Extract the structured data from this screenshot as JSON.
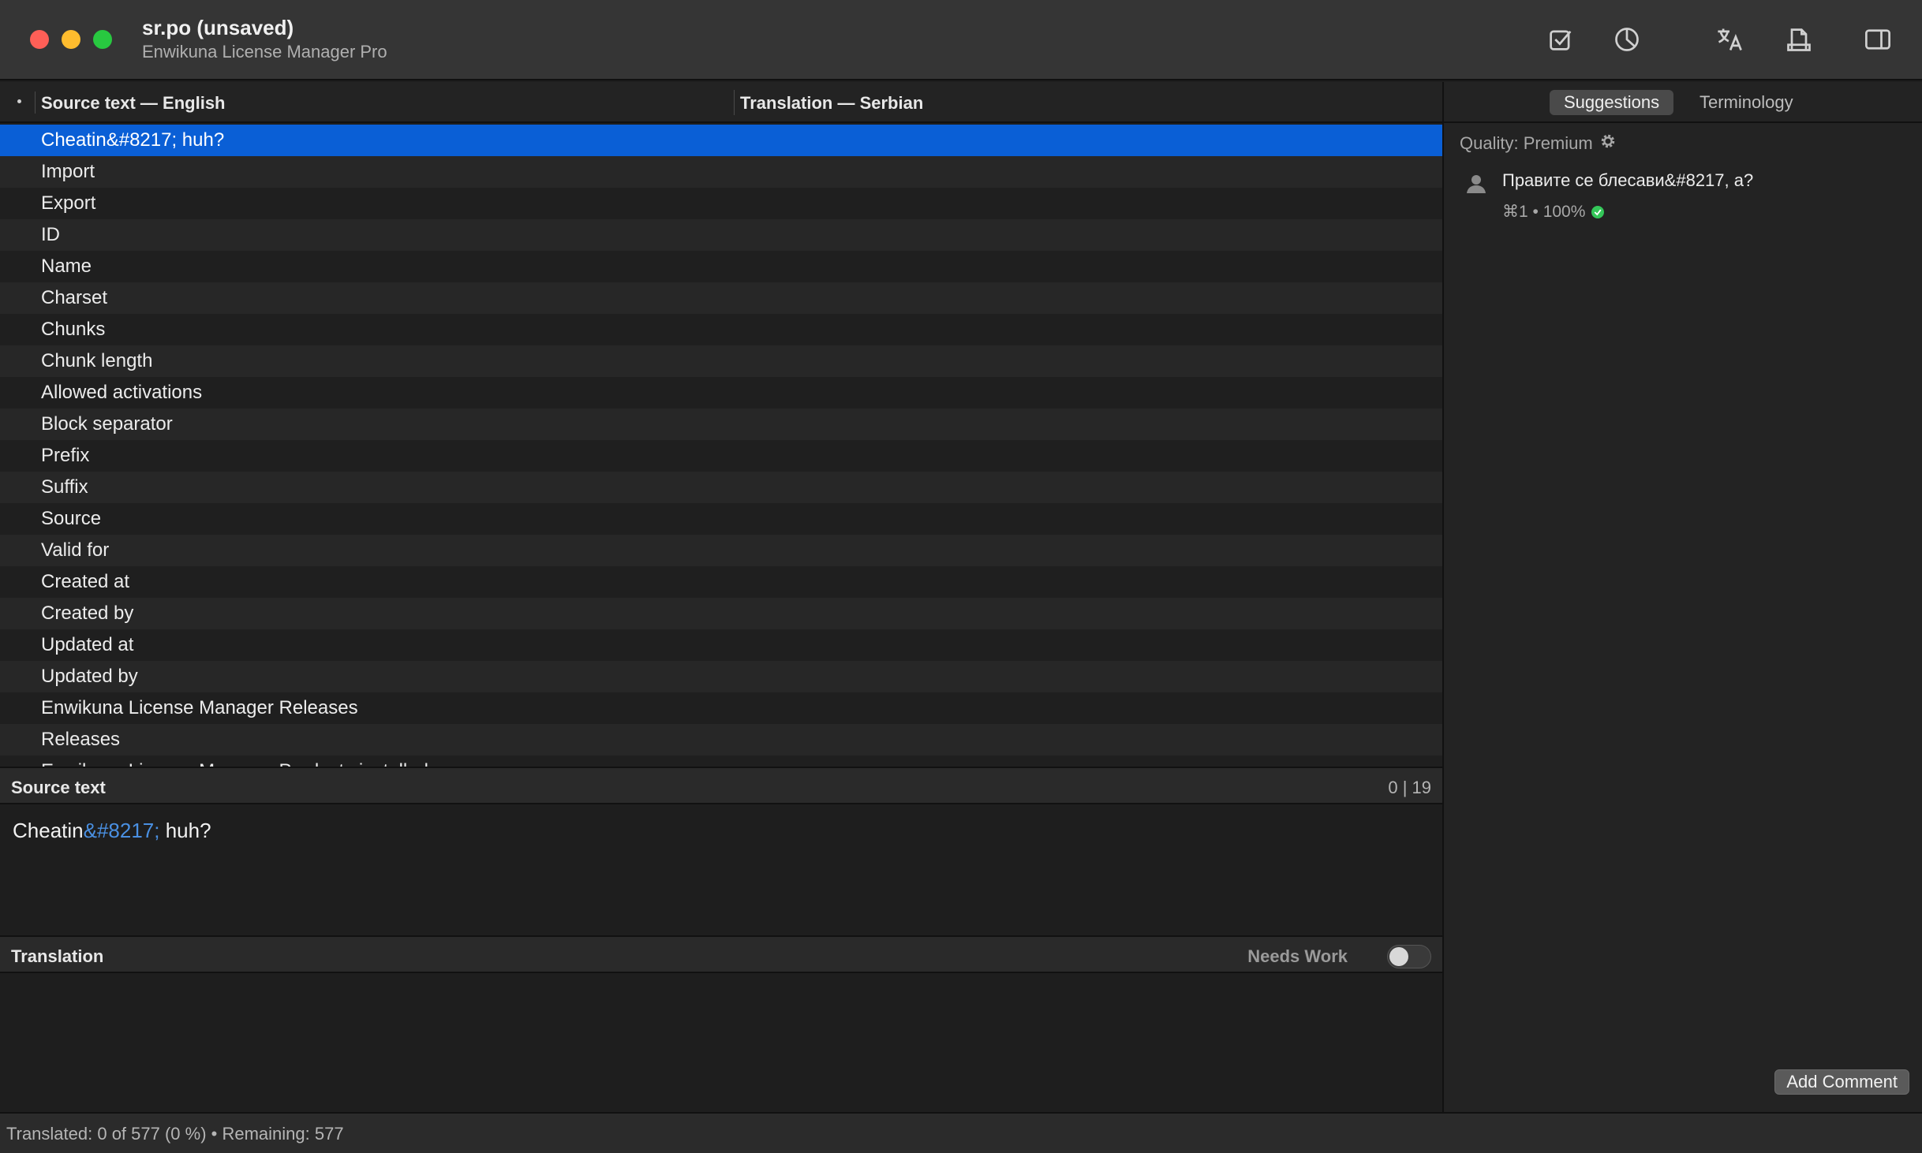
{
  "window": {
    "title": "sr.po (unsaved)",
    "subtitle": "Enwikuna License Manager Pro"
  },
  "toolbar": {
    "icons": [
      "checkbox-icon",
      "pie-chart-icon",
      "translate-icon",
      "document-export-icon",
      "sidebar-toggle-icon"
    ]
  },
  "columns": {
    "source": "Source text — English",
    "translation": "Translation — Serbian"
  },
  "rows": [
    "Cheatin&#8217; huh?",
    "Import",
    "Export",
    "ID",
    "Name",
    "Charset",
    "Chunks",
    "Chunk length",
    "Allowed activations",
    "Block separator",
    "Prefix",
    "Suffix",
    "Source",
    "Valid for",
    "Created at",
    "Created by",
    "Updated at",
    "Updated by",
    "Enwikuna License Manager Releases",
    "Releases",
    "Enwikuna License Manager Products installed"
  ],
  "selected_row_index": 0,
  "source_section": {
    "label": "Source text",
    "count": "0 | 19",
    "text_prefix": "Cheatin",
    "text_entity": "&#8217;",
    "text_suffix": " huh?"
  },
  "translation_section": {
    "label": "Translation",
    "needs_work_label": "Needs Work",
    "needs_work": false
  },
  "sidebar": {
    "tabs": [
      "Suggestions",
      "Terminology"
    ],
    "active_tab": "Suggestions",
    "quality_label": "Quality: Premium",
    "suggestion": {
      "text": "Правите се блесави&#8217, а?",
      "meta": "⌘1 • 100%"
    },
    "add_comment": "Add Comment"
  },
  "status": {
    "text": "Translated: 0 of 577 (0 %)  •  Remaining: 577"
  },
  "colors": {
    "selection": "#0a5fd6",
    "entity": "#4a90e2",
    "success": "#34c759"
  }
}
